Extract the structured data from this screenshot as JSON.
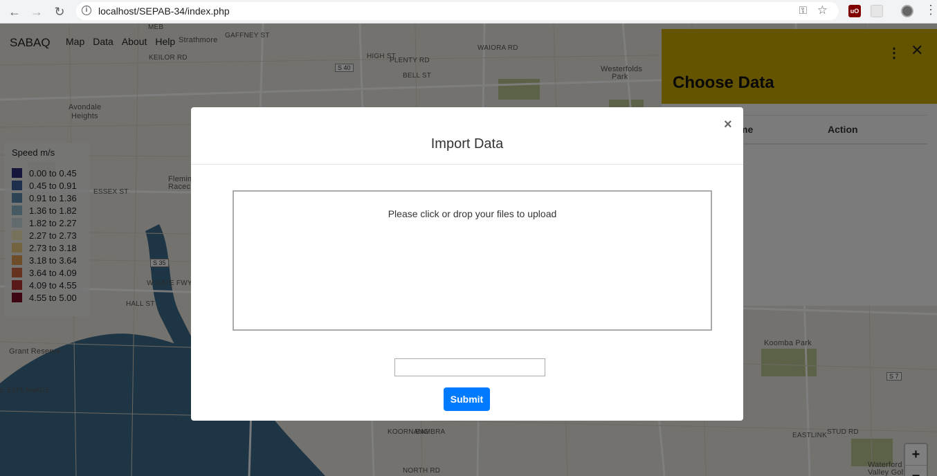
{
  "browser": {
    "url": "localhost/SEPAB-34/index.php"
  },
  "app": {
    "brand": "SABAQ",
    "nav": [
      "Map",
      "Data",
      "About",
      "Help"
    ]
  },
  "map_labels": {
    "meb": "MEB",
    "gaffney": "GAFFNEY ST",
    "strathmore": "Strathmore",
    "keilor": "KEILOR RD",
    "s40": "S 40",
    "high_st": "HIGH ST",
    "plenty_rd": "PLENTY RD",
    "bell_st": "BELL ST",
    "waiora": "WAIORA RD",
    "westerfolds": "Westerfolds",
    "park": "Park",
    "avondale": "Avondale",
    "heights": "Heights",
    "essex": "ESSEX ST",
    "fleming": "Fleming",
    "racecourse": "Racec",
    "s35": "S 35",
    "wgate": "W GATE FWY",
    "hall_st": "HALL ST",
    "grant": "Grant Reserve",
    "esplanade": "E ESPLANADE",
    "koomba": "Koomba Park",
    "s7": "S 7",
    "eastlink": "EASTLINK",
    "stud_rd": "STUD RD",
    "waterford": "Waterford",
    "valley_golf": "Valley Golf",
    "north_rd": "NORTH RD",
    "bambra": "BAMBRA",
    "koornang": "KOORNANG"
  },
  "legend": {
    "title": "Speed m/s",
    "items": [
      {
        "label": "0.00 to 0.45",
        "color": "#2c2c7a"
      },
      {
        "label": "0.45 to 0.91",
        "color": "#3b5e9a"
      },
      {
        "label": "0.91 to 1.36",
        "color": "#5b88ad"
      },
      {
        "label": "1.36 to 1.82",
        "color": "#8db4c9"
      },
      {
        "label": "1.82 to 2.27",
        "color": "#c3d6dd"
      },
      {
        "label": "2.27 to 2.73",
        "color": "#ede6b4"
      },
      {
        "label": "2.73 to 3.18",
        "color": "#e7c77e"
      },
      {
        "label": "3.18 to 3.64",
        "color": "#dd9a55"
      },
      {
        "label": "3.64 to 4.09",
        "color": "#cd6640"
      },
      {
        "label": "4.09 to 4.55",
        "color": "#b33330"
      },
      {
        "label": "4.55 to 5.00",
        "color": "#7a0c24"
      }
    ]
  },
  "zoom": {
    "in": "+",
    "out": "−"
  },
  "side_panel": {
    "title": "Choose Data",
    "columns": [
      "me",
      "Action"
    ],
    "accent": "#c9a800"
  },
  "modal": {
    "title": "Import Data",
    "close": "×",
    "dropzone_message": "Please click or drop your files to upload",
    "submit_label": "Submit",
    "submit_color": "#007bff"
  }
}
